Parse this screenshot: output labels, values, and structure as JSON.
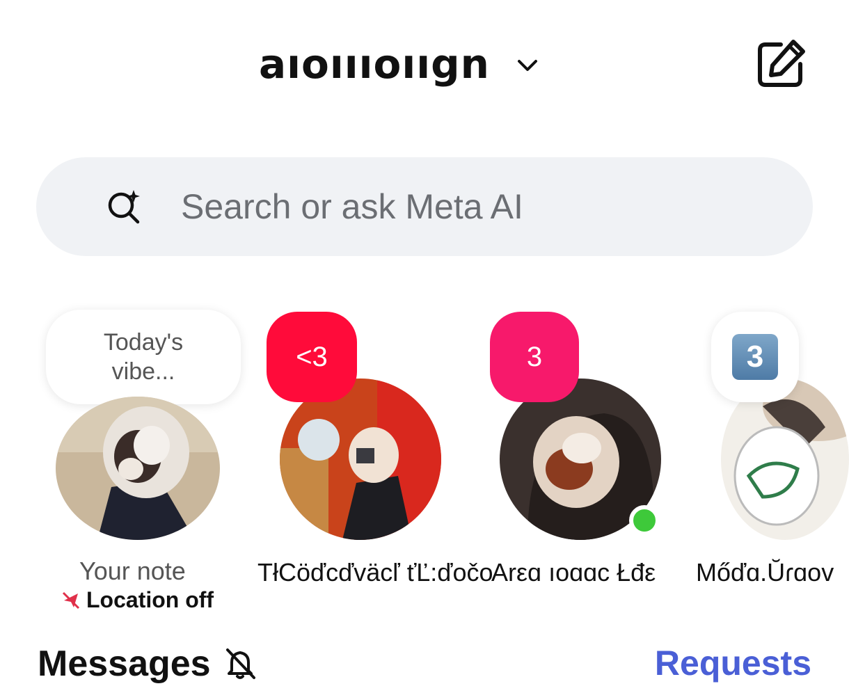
{
  "header": {
    "account_name": "aıoıııoııgn",
    "icons": {
      "chevron": "chevron-down-icon",
      "compose": "compose-icon"
    }
  },
  "search": {
    "placeholder": "Search or ask Meta AI",
    "icon": "meta-ai-search-icon"
  },
  "notes": [
    {
      "note_text": "Today's vibe...",
      "name": "Your note",
      "sub_label": "Location off",
      "sub_icon": "location-off-icon"
    },
    {
      "badge_text": "<3",
      "badge_color": "#ff0b3a",
      "name": "TłCöďcďväcľ ťĽ:ďočo"
    },
    {
      "badge_text": "3",
      "badge_color": "#f7196b",
      "name": "Arεɑ ıoɑɑc  Łđε",
      "online": true
    },
    {
      "badge_text": "3",
      "badge_style": "keycap",
      "name": "Mőďɑ.Ŭɾɑov"
    }
  ],
  "messages": {
    "title": "Messages",
    "requests_label": "Requests",
    "requests_color": "#4a5fd6"
  }
}
